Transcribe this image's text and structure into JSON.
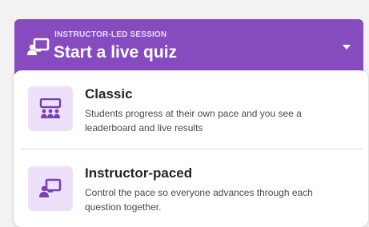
{
  "header": {
    "eyebrow": "INSTRUCTOR-LED SESSION",
    "title": "Start a live quiz",
    "icon": "presenter-icon",
    "bg_color": "#864cbf"
  },
  "options": [
    {
      "title": "Classic",
      "description": "Students progress at their own pace and you see a leaderboard and live results",
      "icon": "classroom-icon"
    },
    {
      "title": "Instructor-paced",
      "description": "Control the pace so everyone advances through each question together.",
      "icon": "presenter-icon"
    }
  ],
  "colors": {
    "accent": "#864cbf",
    "icon_bg": "#ece1f8",
    "icon_fg": "#7a3fb5"
  }
}
